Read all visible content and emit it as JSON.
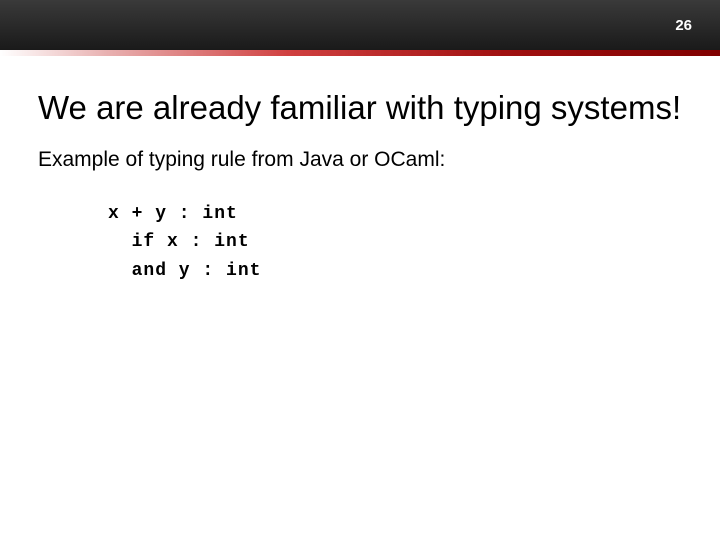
{
  "header": {
    "page_number": "26"
  },
  "slide": {
    "title": "We are already familiar with typing systems!",
    "subtitle": "Example of typing rule from Java or OCaml:",
    "code": "x + y : int\n  if x : int\n  and y : int"
  }
}
